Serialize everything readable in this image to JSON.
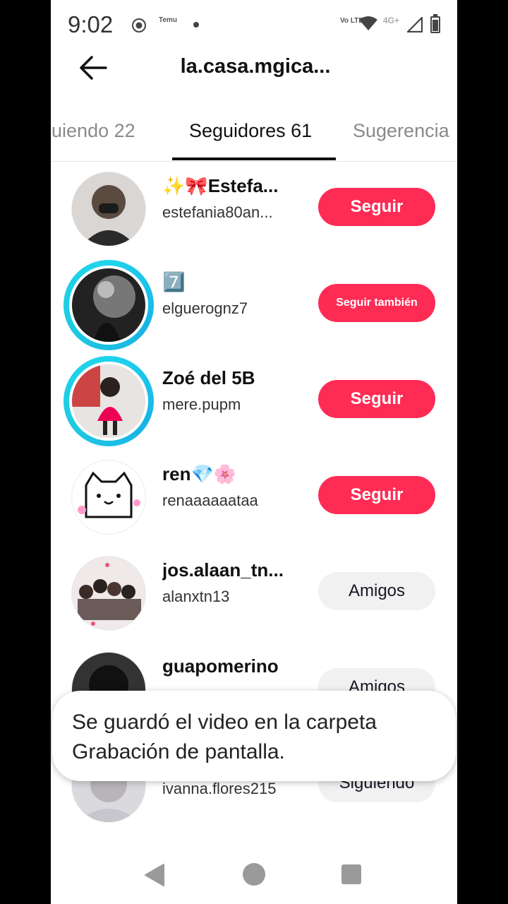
{
  "status_bar": {
    "time": "9:02",
    "temu_label": "Temu",
    "volte_label": "Vo LTE",
    "network_label": "4G+",
    "icons": [
      "screen-record-icon",
      "temu-icon",
      "notification-dot-icon",
      "volte-icon",
      "wifi-icon",
      "signal-icon",
      "battery-icon"
    ]
  },
  "header": {
    "title": "la.casa.mgica...",
    "back_icon": "arrow-left-icon"
  },
  "tabs": [
    {
      "label": "guiendo 22",
      "active": false
    },
    {
      "label": "Seguidores 61",
      "active": true
    },
    {
      "label": "Sugerencia",
      "active": false
    }
  ],
  "rows": [
    {
      "name": "✨🎀Estefa...",
      "handle": "estefania80an...",
      "button": "Seguir",
      "story": false
    },
    {
      "name": "7️⃣",
      "handle": "elguerognz7",
      "button": "Seguir también",
      "story": true
    },
    {
      "name": "Zoé del 5B",
      "handle": "mere.pupm",
      "button": "Seguir",
      "story": true
    },
    {
      "name": "ren💎🌸",
      "handle": "renaaaaaataa",
      "button": "Seguir",
      "story": false
    },
    {
      "name": "jos.alaan_tn...",
      "handle": "alanxtn13",
      "button": "Amigos",
      "story": false
    },
    {
      "name": "guapomerino",
      "handle": "",
      "button": "Amigos",
      "story": false
    },
    {
      "name": "",
      "handle": "ivanna.flores215",
      "button": "Siguiendo",
      "story": false
    }
  ],
  "toast": {
    "text": "Se guardó el video en la carpeta Grabación de pantalla."
  },
  "navbar": {
    "icons": [
      "nav-back-icon",
      "nav-home-icon",
      "nav-recents-icon"
    ]
  },
  "colors": {
    "primary_button": "#fe2c55",
    "secondary_button": "#f1f1f2",
    "story_ring": "#20d5ec"
  }
}
